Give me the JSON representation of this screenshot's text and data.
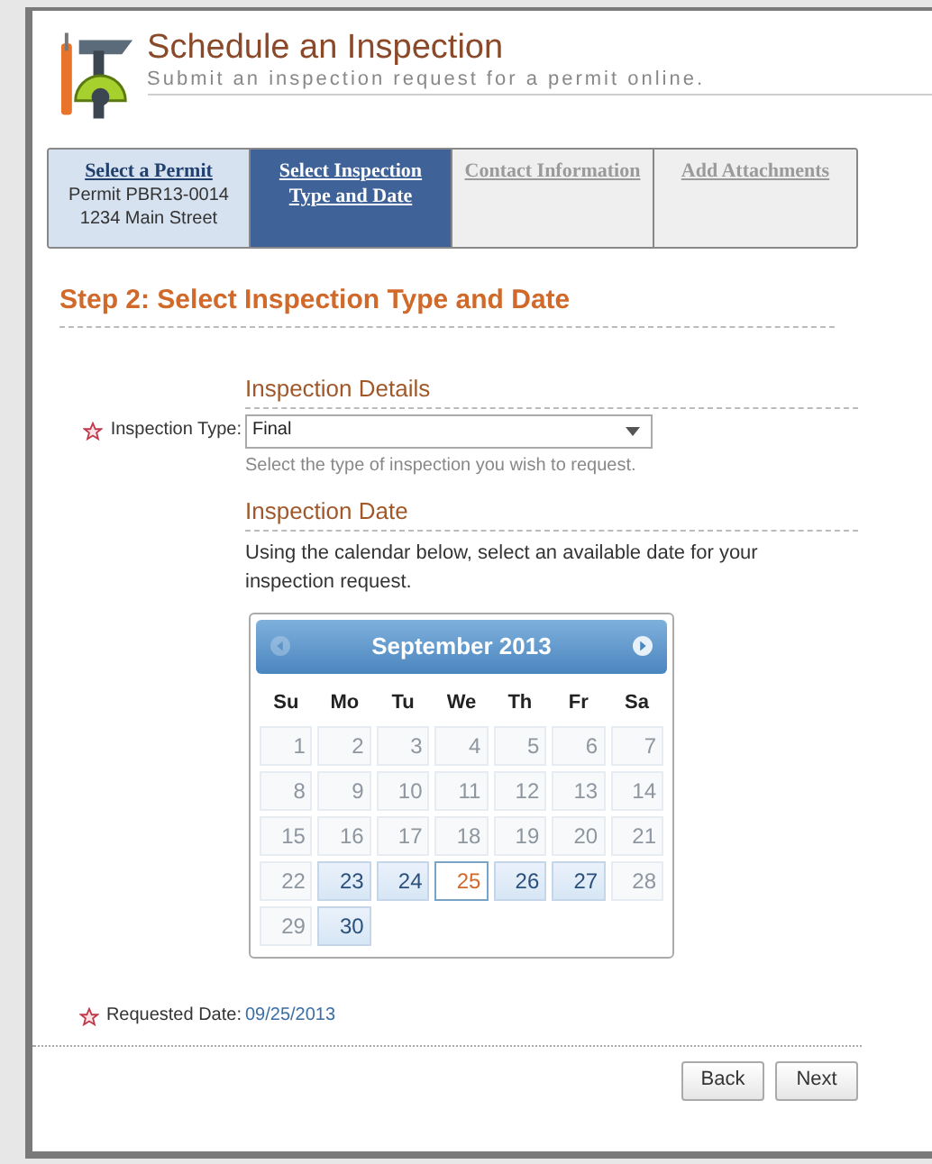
{
  "header": {
    "title": "Schedule an Inspection",
    "subtitle": "Submit an inspection request for a permit online."
  },
  "steps": [
    {
      "title": "Select a Permit",
      "lines": [
        "Permit PBR13-0014",
        "1234 Main Street"
      ],
      "selected": false,
      "disabled": false
    },
    {
      "title": "Select Inspection Type and Date",
      "selected": true,
      "disabled": false
    },
    {
      "title": "Contact Information",
      "selected": false,
      "disabled": true
    },
    {
      "title": "Add Attachments",
      "selected": false,
      "disabled": true
    }
  ],
  "step_heading": "Step 2: Select Inspection Type and Date",
  "details": {
    "heading": "Inspection Details",
    "type_label": "Inspection Type:",
    "type_value": "Final",
    "type_hint": "Select the type of inspection you wish to request."
  },
  "date_section": {
    "heading": "Inspection Date",
    "instructions": "Using the calendar below, select an available date for your inspection request."
  },
  "calendar": {
    "month": "September 2013",
    "prev_enabled": false,
    "next_enabled": true,
    "weekdays": [
      "Su",
      "Mo",
      "Tu",
      "We",
      "Th",
      "Fr",
      "Sa"
    ],
    "weeks": [
      [
        {
          "day": "1",
          "available": false,
          "selected": false
        },
        {
          "day": "2",
          "available": false,
          "selected": false
        },
        {
          "day": "3",
          "available": false,
          "selected": false
        },
        {
          "day": "4",
          "available": false,
          "selected": false
        },
        {
          "day": "5",
          "available": false,
          "selected": false
        },
        {
          "day": "6",
          "available": false,
          "selected": false
        },
        {
          "day": "7",
          "available": false,
          "selected": false
        }
      ],
      [
        {
          "day": "8",
          "available": false,
          "selected": false
        },
        {
          "day": "9",
          "available": false,
          "selected": false
        },
        {
          "day": "10",
          "available": false,
          "selected": false
        },
        {
          "day": "11",
          "available": false,
          "selected": false
        },
        {
          "day": "12",
          "available": false,
          "selected": false
        },
        {
          "day": "13",
          "available": false,
          "selected": false
        },
        {
          "day": "14",
          "available": false,
          "selected": false
        }
      ],
      [
        {
          "day": "15",
          "available": false,
          "selected": false
        },
        {
          "day": "16",
          "available": false,
          "selected": false
        },
        {
          "day": "17",
          "available": false,
          "selected": false
        },
        {
          "day": "18",
          "available": false,
          "selected": false
        },
        {
          "day": "19",
          "available": false,
          "selected": false
        },
        {
          "day": "20",
          "available": false,
          "selected": false
        },
        {
          "day": "21",
          "available": false,
          "selected": false
        }
      ],
      [
        {
          "day": "22",
          "available": false,
          "selected": false
        },
        {
          "day": "23",
          "available": true,
          "selected": false
        },
        {
          "day": "24",
          "available": true,
          "selected": false
        },
        {
          "day": "25",
          "available": true,
          "selected": true
        },
        {
          "day": "26",
          "available": true,
          "selected": false
        },
        {
          "day": "27",
          "available": true,
          "selected": false
        },
        {
          "day": "28",
          "available": false,
          "selected": false
        }
      ],
      [
        {
          "day": "29",
          "available": false,
          "selected": false
        },
        {
          "day": "30",
          "available": true,
          "selected": false
        }
      ]
    ]
  },
  "requested": {
    "label": "Requested Date:",
    "value": "09/25/2013"
  },
  "buttons": [
    "Back",
    "Next"
  ]
}
